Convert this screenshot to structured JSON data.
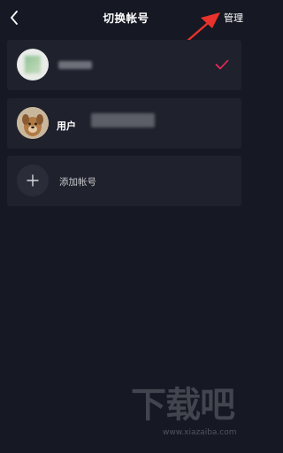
{
  "header": {
    "title": "切换帐号",
    "manage_label": "管理",
    "back_icon": "back-chevron-icon"
  },
  "accounts": [
    {
      "name": "",
      "selected": true,
      "check_icon": "checkmark-icon",
      "check_color": "#f2295b"
    },
    {
      "name": "用户",
      "selected": false
    }
  ],
  "add_account": {
    "label": "添加帐号",
    "icon": "plus-icon"
  },
  "annotation": {
    "arrow_color": "#e8322b"
  },
  "watermark": {
    "text": "下载吧",
    "url": "www.xiazaiba.com"
  }
}
